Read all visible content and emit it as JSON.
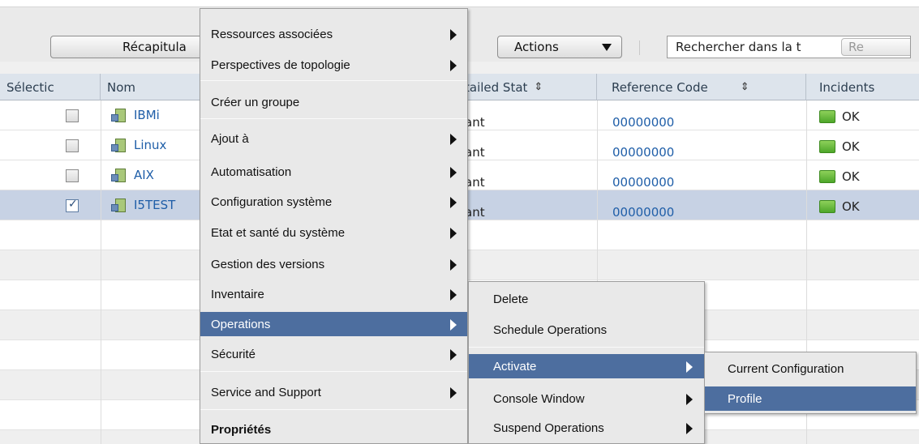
{
  "toolbar": {
    "recap_label": "Récapitula",
    "actions_label": "Actions",
    "search_value": "Rechercher dans la t",
    "search_btn_label": "Re"
  },
  "table": {
    "headers": {
      "select": "Sélectic",
      "name": "Nom",
      "detailed": "tailed Stat",
      "ref": "Reference Code",
      "incidents": "Incidents"
    },
    "rows": [
      {
        "name": "IBMi",
        "detail": "ant",
        "ref": "00000000",
        "incident": "OK",
        "checked": false
      },
      {
        "name": "Linux",
        "detail": "ant",
        "ref": "00000000",
        "incident": "OK",
        "checked": false
      },
      {
        "name": "AIX",
        "detail": "ant",
        "ref": "00000000",
        "incident": "OK",
        "checked": false
      },
      {
        "name": "I5TEST",
        "detail": "ant",
        "ref": "00000000",
        "incident": "OK",
        "checked": true
      }
    ]
  },
  "menu_main": {
    "items": [
      {
        "label": "Ressources associées",
        "submenu": true
      },
      {
        "label": "Perspectives de topologie",
        "submenu": true
      },
      {
        "label": "Créer un groupe",
        "submenu": false
      },
      {
        "label": "Ajout à",
        "submenu": true
      },
      {
        "label": "Automatisation",
        "submenu": true
      },
      {
        "label": "Configuration système",
        "submenu": true
      },
      {
        "label": "Etat et santé du système",
        "submenu": true
      },
      {
        "label": "Gestion des versions",
        "submenu": true
      },
      {
        "label": "Inventaire",
        "submenu": true
      },
      {
        "label": "Operations",
        "submenu": true,
        "active": true
      },
      {
        "label": "Sécurité",
        "submenu": true
      },
      {
        "label": "Service and Support",
        "submenu": true
      },
      {
        "label": "Propriétés",
        "submenu": false
      }
    ]
  },
  "menu_operations": {
    "items": [
      {
        "label": "Delete"
      },
      {
        "label": "Schedule Operations"
      },
      {
        "label": "Activate",
        "active": true
      },
      {
        "label": "Console Window"
      },
      {
        "label": "Suspend Operations"
      }
    ]
  },
  "menu_activate": {
    "items": [
      {
        "label": "Current Configuration"
      },
      {
        "label": "Profile",
        "active": true
      }
    ]
  },
  "colors": {
    "menu_highlight": "#4d6e9f",
    "link": "#1f5ea8",
    "selected_row": "#c7d2e4",
    "ok_green": "#4ea62a"
  }
}
